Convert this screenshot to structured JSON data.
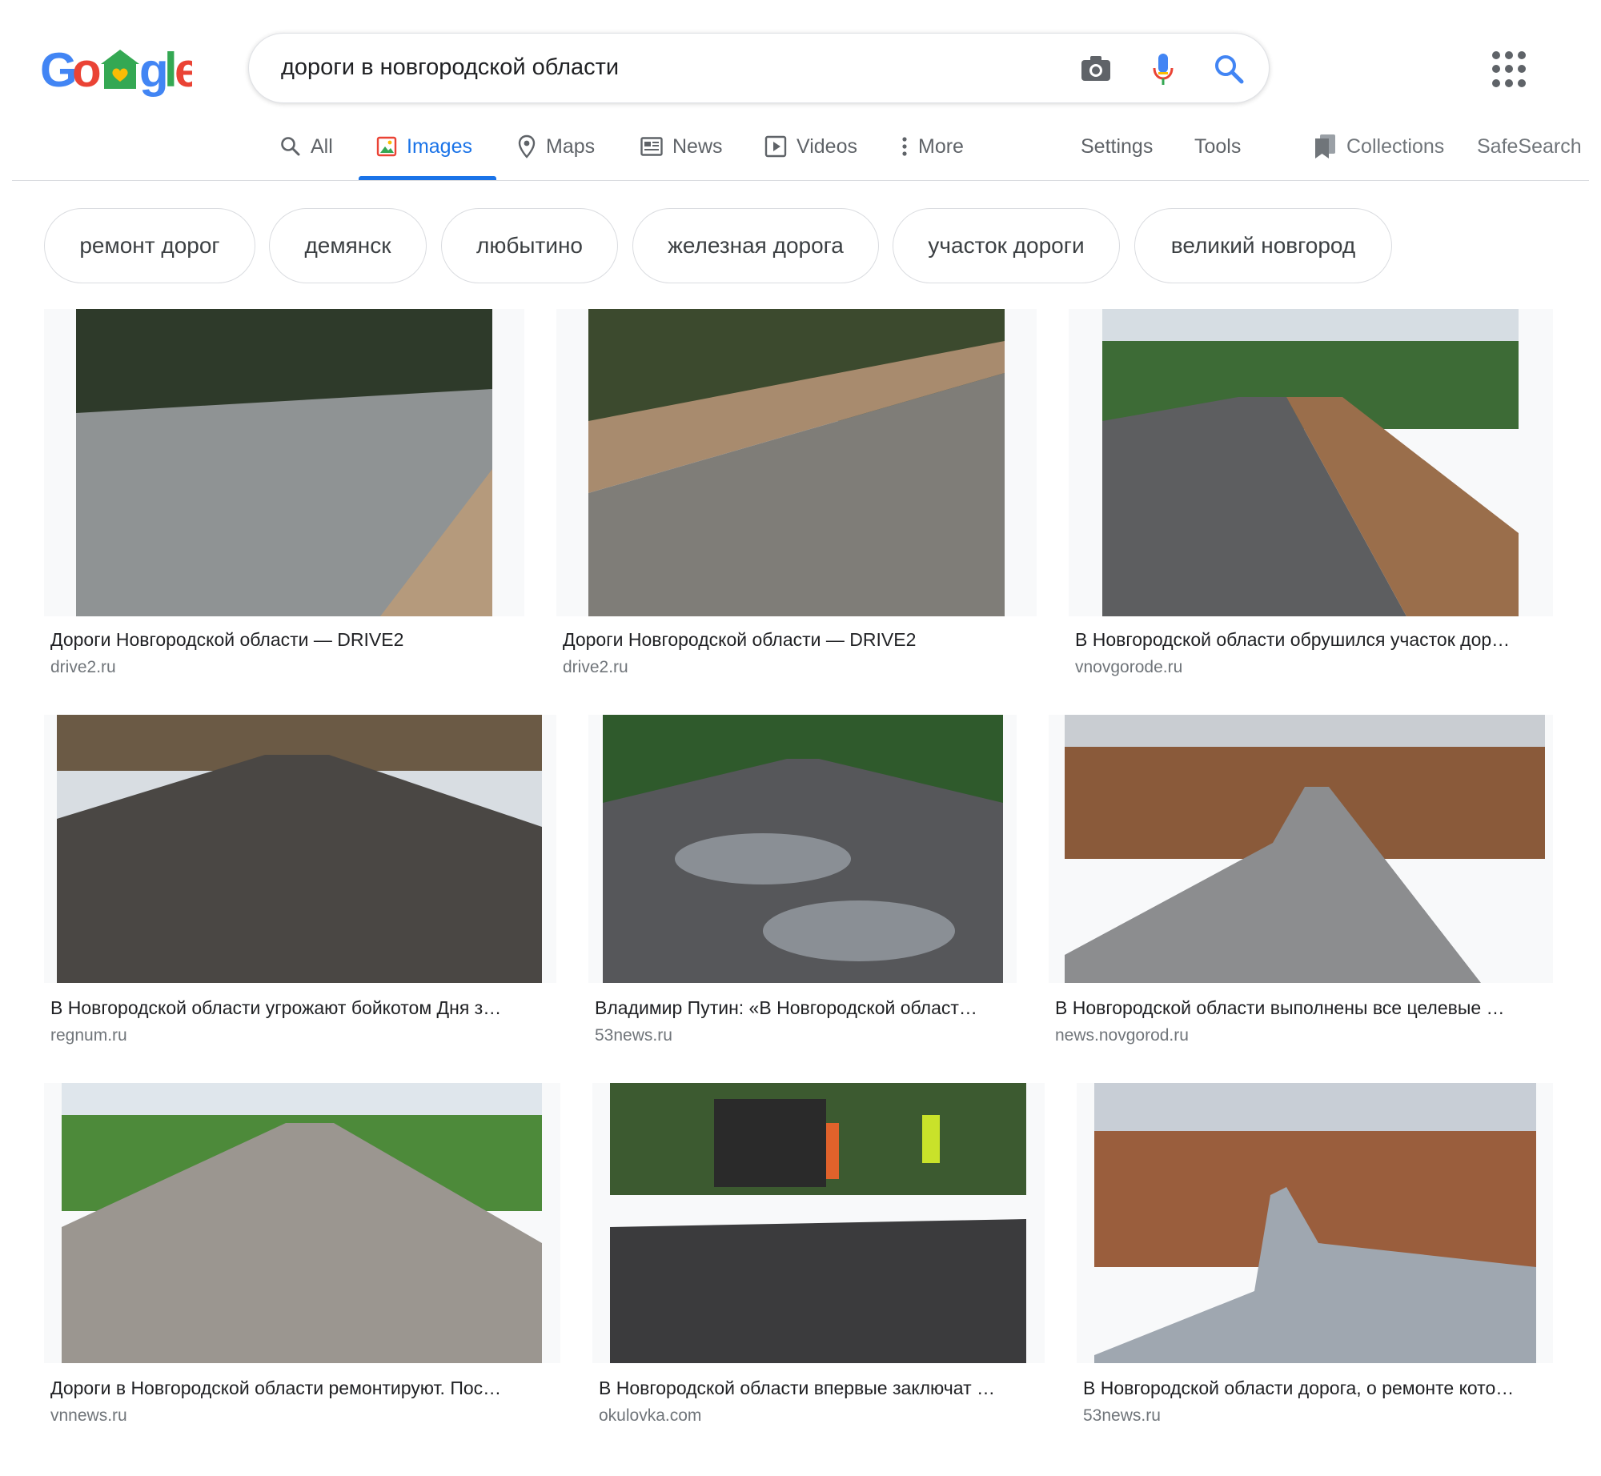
{
  "search": {
    "query": "дороги в новгородской области"
  },
  "nav": {
    "tabs": [
      {
        "label": "All"
      },
      {
        "label": "Images"
      },
      {
        "label": "Maps"
      },
      {
        "label": "News"
      },
      {
        "label": "Videos"
      },
      {
        "label": "More"
      }
    ],
    "settings": "Settings",
    "tools": "Tools",
    "collections": "Collections",
    "safesearch": "SafeSearch"
  },
  "chips": [
    "ремонт дорог",
    "демянск",
    "любытино",
    "железная дорога",
    "участок дороги",
    "великий новгород"
  ],
  "results": [
    {
      "caption": "Дороги Новгородской области — DRIVE2",
      "source": "drive2.ru",
      "palette": [
        "#2e3a2a",
        "#8f9394",
        "#b59a7c"
      ]
    },
    {
      "caption": "Дороги Новгородской области — DRIVE2",
      "source": "drive2.ru",
      "palette": [
        "#3c4a2e",
        "#7f7d78",
        "#a88b6e"
      ]
    },
    {
      "caption": "В Новгородской области обрушился участок дор…",
      "source": "vnovgorode.ru",
      "palette": [
        "#3d6b36",
        "#5d5e60",
        "#9a6e4b"
      ]
    },
    {
      "caption": "В Новгородской области угрожают бойкотом Дня з…",
      "source": "regnum.ru",
      "palette": [
        "#6b5a45",
        "#4a4744",
        "#d8dde2"
      ]
    },
    {
      "caption": "Владимир Путин: «В Новгородской област…",
      "source": "53news.ru",
      "palette": [
        "#2f5a2c",
        "#56575a",
        "#8a8f95"
      ]
    },
    {
      "caption": "В Новгородской области выполнены все целевые …",
      "source": "news.novgorod.ru",
      "palette": [
        "#8a5a3a",
        "#8c8d8f",
        "#c9cdd2"
      ]
    },
    {
      "caption": "Дороги в Новгородской области ремонтируют. Пос…",
      "source": "vnnews.ru",
      "palette": [
        "#4d8a3a",
        "#9b9690",
        "#dfe6ec"
      ]
    },
    {
      "caption": "В Новгородской области впервые заключат …",
      "source": "okulovka.com",
      "palette": [
        "#3c5a30",
        "#3b3b3d",
        "#e0622b"
      ]
    },
    {
      "caption": "В Новгородской области дорога, о ремонте кото…",
      "source": "53news.ru",
      "palette": [
        "#9a5e3d",
        "#9fa7b0",
        "#c8ced6"
      ]
    }
  ]
}
